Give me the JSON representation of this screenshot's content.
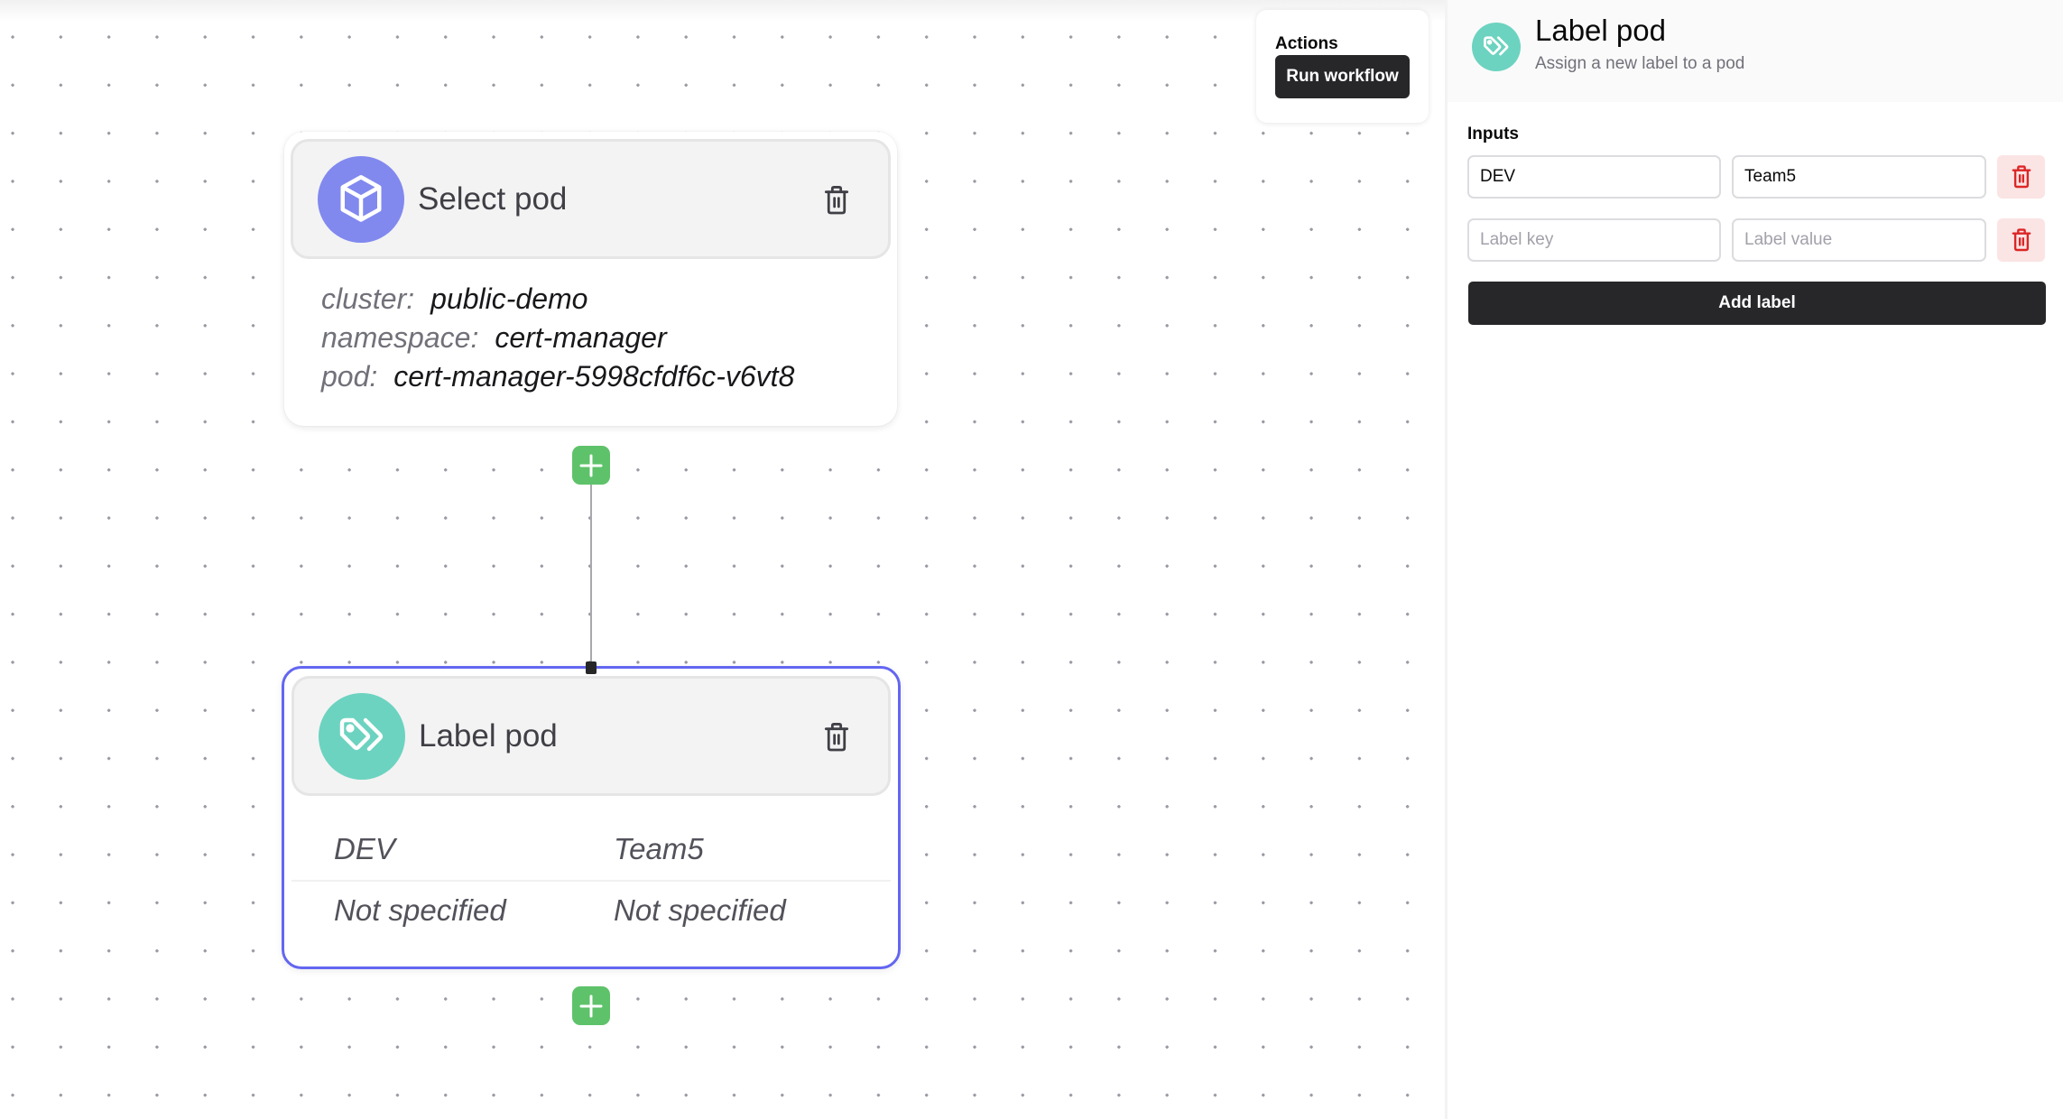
{
  "colors": {
    "select_pod_icon_bg": "#8189ef",
    "label_pod_icon_bg": "#6cd3c0",
    "add_button": "#5ec26a",
    "selected_border": "#6366f1",
    "danger": "#dc2626",
    "danger_bg": "#fbe4e4",
    "primary_button": "#27272a"
  },
  "actions": {
    "title": "Actions",
    "run_workflow_label": "Run workflow"
  },
  "workflow": {
    "nodes": [
      {
        "icon": "cube-icon",
        "title": "Select pod",
        "fields": [
          {
            "key": "cluster:",
            "value": "public-demo"
          },
          {
            "key": "namespace:",
            "value": "cert-manager"
          },
          {
            "key": "pod:",
            "value": "cert-manager-5998cfdf6c-v6vt8"
          }
        ]
      },
      {
        "icon": "tags-icon",
        "title": "Label pod",
        "selected": true,
        "labels": [
          {
            "key": "DEV",
            "value": "Team5"
          },
          {
            "key": "Not specified",
            "value": "Not specified"
          }
        ]
      }
    ]
  },
  "panel": {
    "icon": "tags-icon",
    "title": "Label pod",
    "subtitle": "Assign a new label to a pod",
    "inputs_label": "Inputs",
    "rows": [
      {
        "key_value": "DEV",
        "value_value": "Team5",
        "key_placeholder": "Label key",
        "value_placeholder": "Label value"
      },
      {
        "key_value": "",
        "value_value": "",
        "key_placeholder": "Label key",
        "value_placeholder": "Label value"
      }
    ],
    "add_label_button": "Add label"
  }
}
